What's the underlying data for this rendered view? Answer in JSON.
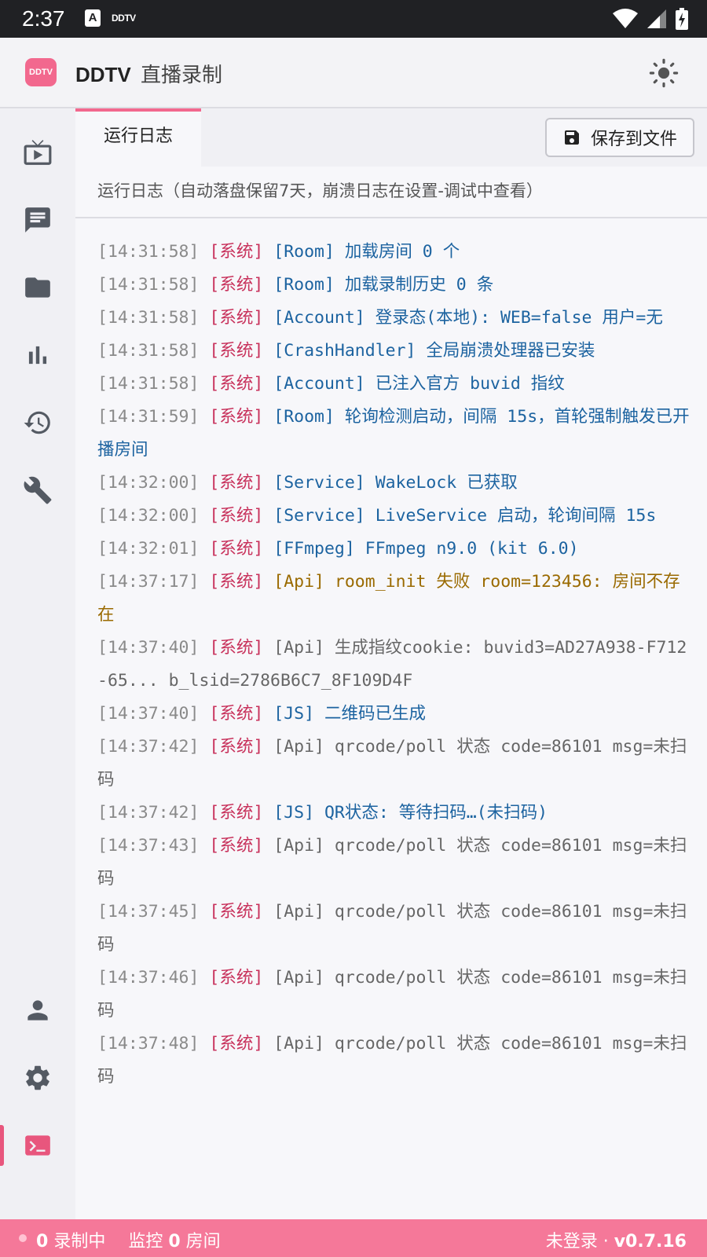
{
  "status_bar": {
    "time": "2:37",
    "notif_a": "A",
    "notif_ddtv": "DDTV"
  },
  "app": {
    "logo_text": "DDTV",
    "title_brand": "DDTV",
    "title_sub": "直播录制"
  },
  "tabs": {
    "active_label": "运行日志",
    "save_label": "保存到文件"
  },
  "subheader": "运行日志（自动落盘保留7天，崩溃日志在设置-调试中查看）",
  "log": [
    {
      "time": "[14:31:58]",
      "tag": "[系统]",
      "msg": "[Room] 加载房间 0 个",
      "level": "info"
    },
    {
      "time": "[14:31:58]",
      "tag": "[系统]",
      "msg": "[Room] 加载录制历史 0 条",
      "level": "info"
    },
    {
      "time": "[14:31:58]",
      "tag": "[系统]",
      "msg": "[Account] 登录态(本地): WEB=false 用户=无",
      "level": "info"
    },
    {
      "time": "[14:31:58]",
      "tag": "[系统]",
      "msg": "[CrashHandler] 全局崩溃处理器已安装",
      "level": "info"
    },
    {
      "time": "[14:31:58]",
      "tag": "[系统]",
      "msg": "[Account] 已注入官方 buvid 指纹",
      "level": "info"
    },
    {
      "time": "[14:31:59]",
      "tag": "[系统]",
      "msg": "[Room] 轮询检测启动，间隔 15s，首轮强制触发已开播房间",
      "level": "info"
    },
    {
      "time": "[14:32:00]",
      "tag": "[系统]",
      "msg": "[Service] WakeLock 已获取",
      "level": "info"
    },
    {
      "time": "[14:32:00]",
      "tag": "[系统]",
      "msg": "[Service] LiveService 启动，轮询间隔 15s",
      "level": "info"
    },
    {
      "time": "[14:32:01]",
      "tag": "[系统]",
      "msg": "[FFmpeg] FFmpeg n9.0 (kit 6.0)",
      "level": "info"
    },
    {
      "time": "[14:37:17]",
      "tag": "[系统]",
      "msg": "[Api] room_init 失败 room=123456: 房间不存在",
      "level": "warn"
    },
    {
      "time": "[14:37:40]",
      "tag": "[系统]",
      "msg": "[Api] 生成指纹cookie: buvid3=AD27A938-F712-65... b_lsid=2786B6C7_8F109D4F",
      "level": "plain"
    },
    {
      "time": "[14:37:40]",
      "tag": "[系统]",
      "msg": "[JS] 二维码已生成",
      "level": "info"
    },
    {
      "time": "[14:37:42]",
      "tag": "[系统]",
      "msg": "[Api] qrcode/poll 状态 code=86101 msg=未扫码",
      "level": "plain"
    },
    {
      "time": "[14:37:42]",
      "tag": "[系统]",
      "msg": "[JS] QR状态: 等待扫码…(未扫码)",
      "level": "info"
    },
    {
      "time": "[14:37:43]",
      "tag": "[系统]",
      "msg": "[Api] qrcode/poll 状态 code=86101 msg=未扫码",
      "level": "plain"
    },
    {
      "time": "[14:37:45]",
      "tag": "[系统]",
      "msg": "[Api] qrcode/poll 状态 code=86101 msg=未扫码",
      "level": "plain"
    },
    {
      "time": "[14:37:46]",
      "tag": "[系统]",
      "msg": "[Api] qrcode/poll 状态 code=86101 msg=未扫码",
      "level": "plain"
    },
    {
      "time": "[14:37:48]",
      "tag": "[系统]",
      "msg": "[Api] qrcode/poll 状态 code=86101 msg=未扫码",
      "level": "plain"
    }
  ],
  "footer": {
    "recording_count": "0",
    "recording_label": "录制中",
    "monitor_prefix": "监控",
    "monitor_count": "0",
    "monitor_suffix": "房间",
    "login_status": "未登录",
    "version": "v0.7.16"
  },
  "colors": {
    "accent": "#f2688e",
    "footer_bg": "#f57899",
    "log_tag": "#c8325c",
    "log_info": "#1c63a0",
    "log_warn": "#9a6a00"
  }
}
